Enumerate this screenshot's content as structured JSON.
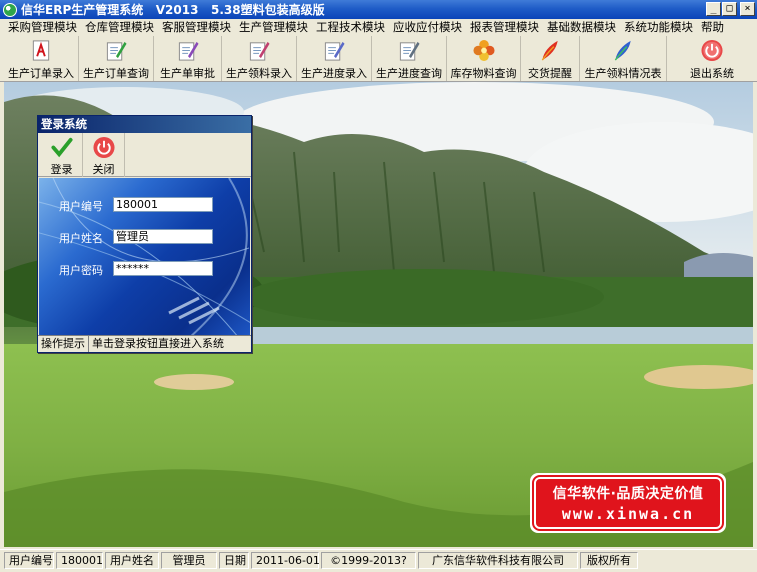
{
  "window": {
    "title": "信华ERP生产管理系统   V2013   5.38塑料包装高级版",
    "buttons": [
      "_",
      "□",
      "×"
    ]
  },
  "menu": [
    "采购管理模块",
    "仓库管理模块",
    "客服管理模块",
    "生产管理模块",
    "工程技术模块",
    "应收应付模块",
    "报表管理模块",
    "基础数据模块",
    "系统功能模块",
    "帮助"
  ],
  "toolbar": [
    {
      "label": "生产订单录入",
      "icon": "pdf-document-icon"
    },
    {
      "label": "生产订单查询",
      "icon": "document-pen-icon"
    },
    {
      "label": "生产单审批",
      "icon": "document-approve-icon"
    },
    {
      "label": "生产领料录入",
      "icon": "document-pencil-icon"
    },
    {
      "label": "生产进度录入",
      "icon": "document-edit-icon"
    },
    {
      "label": "生产进度查询",
      "icon": "document-check-icon"
    },
    {
      "label": "库存物料查询",
      "icon": "flower-icon"
    },
    {
      "label": "交货提醒",
      "icon": "feather-quill-icon"
    },
    {
      "label": "生产领料情况表",
      "icon": "feather-blue-icon"
    },
    {
      "label": "退出系统",
      "icon": "power-icon"
    }
  ],
  "login": {
    "title": "登录系统",
    "login_label": "登录",
    "close_label": "关闭",
    "user_id_label": "用户编号",
    "user_id_value": "180001",
    "user_name_label": "用户姓名",
    "user_name_value": "管理员",
    "password_label": "用户密码",
    "password_value": "******",
    "status_label": "操作提示",
    "status_text": "单击登录按钮直接进入系统"
  },
  "banner": {
    "line1": "信华软件·品质决定价值",
    "line2": "www.xinwa.cn"
  },
  "statusbar": {
    "user_id_label": "用户编号",
    "user_id": "180001",
    "user_name_label": "用户姓名",
    "user_name": "管理员",
    "date_label": "日期",
    "date": "2011-06-01",
    "copyright": "©1999-2013?",
    "company": "广东信华软件科技有限公司",
    "rights": "版权所有"
  }
}
